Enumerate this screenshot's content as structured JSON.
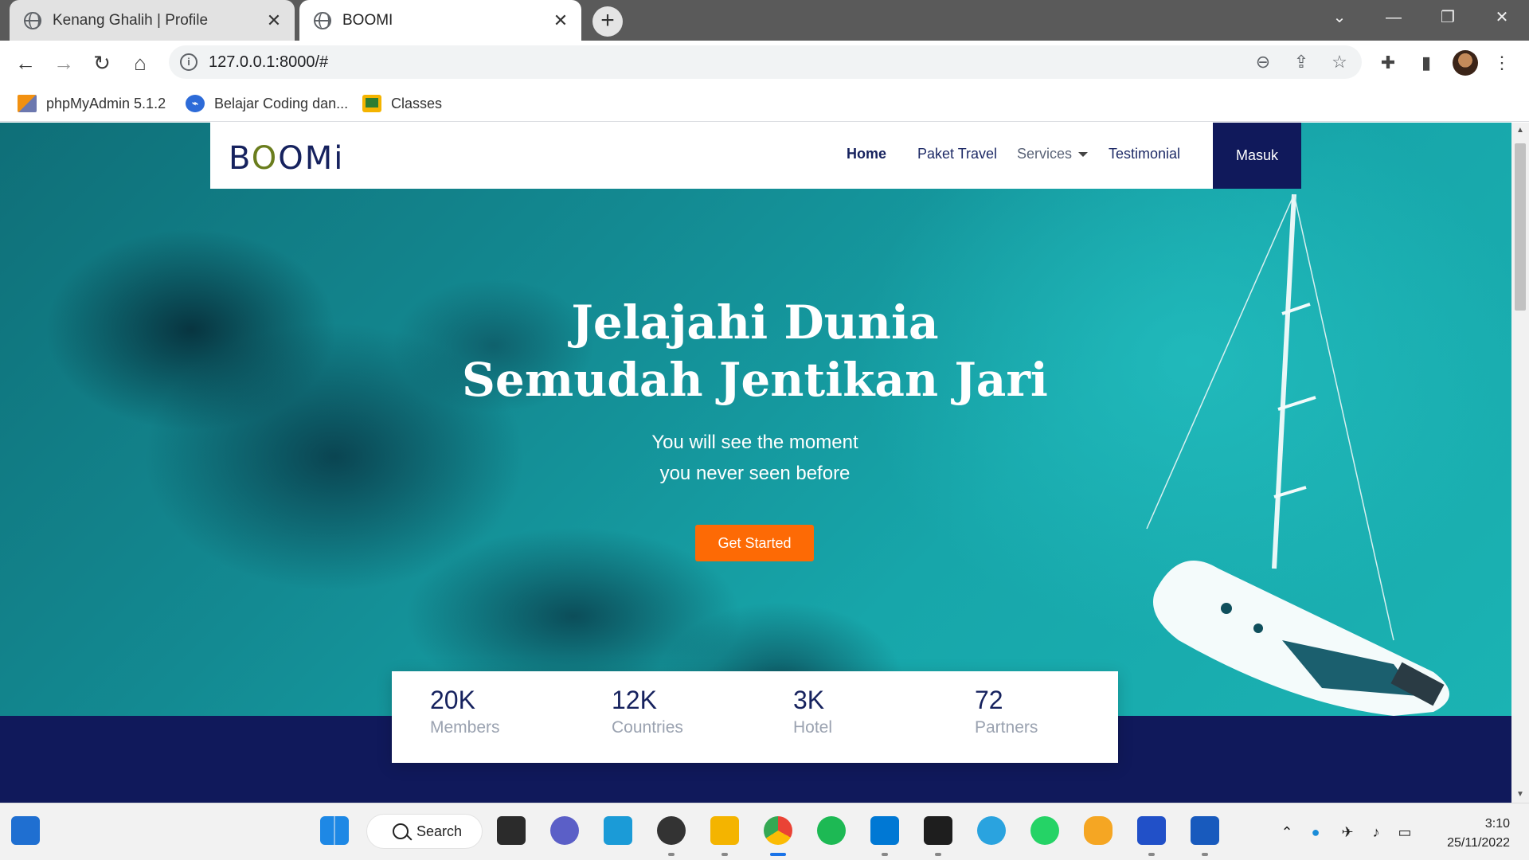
{
  "browser": {
    "tabs": [
      {
        "title": "Kenang Ghalih | Profile",
        "close": "✕"
      },
      {
        "title": "BOOMI",
        "close": "✕"
      }
    ],
    "new_tab": "+",
    "window_controls": {
      "dropdown": "⌄",
      "minimize": "—",
      "restore": "❐",
      "close": "✕"
    },
    "url": "127.0.0.1:8000/#",
    "bookmarks": [
      "phpMyAdmin 5.1.2",
      "Belajar Coding dan...",
      "Classes"
    ]
  },
  "site": {
    "logo": {
      "b": "B",
      "o1": "O",
      "rest": "OMi"
    },
    "nav": {
      "home": "Home",
      "paket_travel": "Paket Travel",
      "services": "Services",
      "testimonial": "Testimonial",
      "masuk": "Masuk"
    },
    "hero": {
      "title_line1": "Jelajahi Dunia",
      "title_line2": "Semudah Jentikan Jari",
      "subtitle_line1": "You will see the moment",
      "subtitle_line2": "you never seen before",
      "cta": "Get Started"
    },
    "stats": [
      {
        "value": "20K",
        "label": "Members"
      },
      {
        "value": "12K",
        "label": "Countries"
      },
      {
        "value": "3K",
        "label": "Hotel"
      },
      {
        "value": "72",
        "label": "Partners"
      }
    ]
  },
  "taskbar": {
    "search": "Search",
    "time": "3:10",
    "date": "25/11/2022"
  },
  "colors": {
    "navy": "#10195b",
    "accent_orange": "#fd6a05",
    "sea": "#17a6aa"
  }
}
